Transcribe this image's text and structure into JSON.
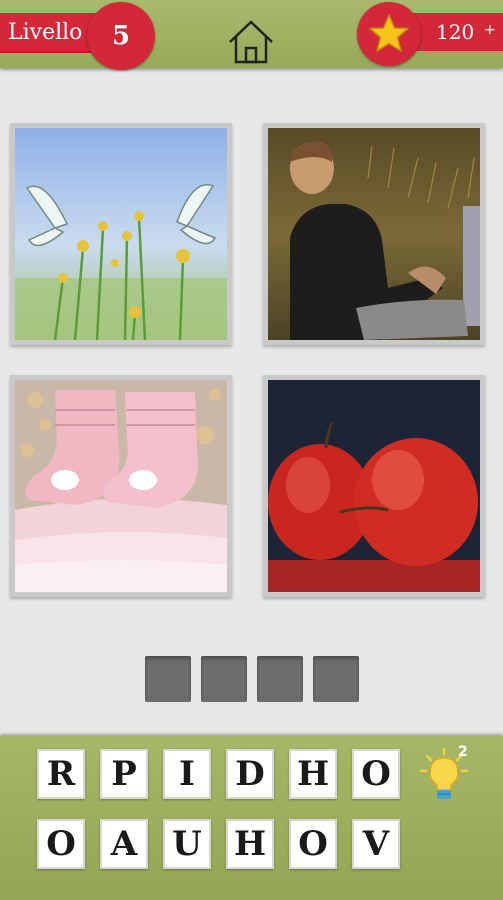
{
  "header": {
    "level_label": "Livello",
    "level_number": "5",
    "coins": "120",
    "coin_plus": "+"
  },
  "icons": {
    "home": "home-icon",
    "star": "star-icon",
    "hint": "lightbulb-icon"
  },
  "images": [
    {
      "subject": "butterflies and yellow wildflowers"
    },
    {
      "subject": "boy sitting in a field"
    },
    {
      "subject": "pink knitted baby booties"
    },
    {
      "subject": "red apples"
    }
  ],
  "answer": {
    "slots": [
      "",
      "",
      "",
      ""
    ]
  },
  "letters": {
    "row1": [
      "R",
      "P",
      "I",
      "D",
      "H",
      "O"
    ],
    "row2": [
      "O",
      "A",
      "U",
      "H",
      "O",
      "V"
    ]
  },
  "hint": {
    "count": "2"
  },
  "colors": {
    "header_green": "#9fb062",
    "accent_red": "#d2283a",
    "background": "#e7e7e7",
    "slot_gray": "#6c6c6c"
  }
}
